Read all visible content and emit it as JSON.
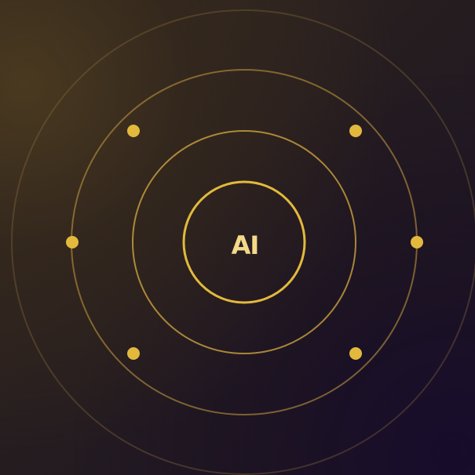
{
  "center": {
    "label": "AI"
  },
  "icons": {
    "orbit_node": "dot-icon"
  },
  "colors": {
    "gold": "#e2b93c",
    "gold_soft": "#c89f3b",
    "text": "#f4d98b",
    "background_warm": "#3a2d20",
    "background_cool": "#1a1424"
  }
}
